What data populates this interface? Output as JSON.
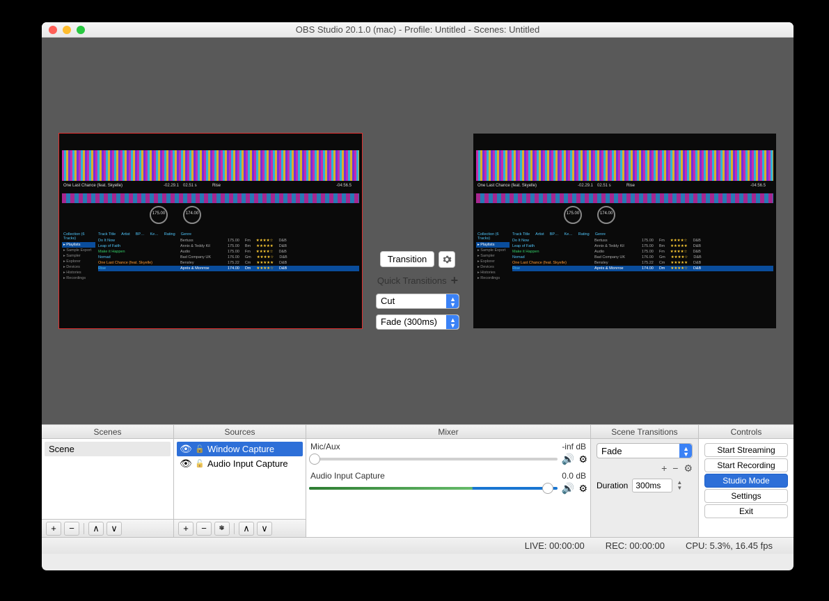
{
  "window": {
    "title": "OBS Studio 20.1.0 (mac) - Profile: Untitled - Scenes: Untitled"
  },
  "transition": {
    "button": "Transition",
    "quick_label": "Quick Transitions",
    "options": [
      "Cut",
      "Fade (300ms)"
    ]
  },
  "panels": {
    "scenes_hdr": "Scenes",
    "sources_hdr": "Sources",
    "mixer_hdr": "Mixer",
    "transitions_hdr": "Scene Transitions",
    "controls_hdr": "Controls"
  },
  "scenes": {
    "items": [
      "Scene"
    ]
  },
  "sources": {
    "items": [
      {
        "name": "Window Capture",
        "selected": true
      },
      {
        "name": "Audio Input Capture",
        "selected": false
      }
    ]
  },
  "mixer": {
    "channels": [
      {
        "name": "Mic/Aux",
        "level": "-inf dB",
        "pos": 0,
        "fill": 0,
        "blue": false
      },
      {
        "name": "Audio Input Capture",
        "level": "0.0 dB",
        "pos": 94,
        "fill": 66,
        "blue": true
      }
    ]
  },
  "scene_transitions": {
    "selected": "Fade",
    "duration_label": "Duration",
    "duration_value": "300ms"
  },
  "controls": {
    "buttons": [
      "Start Streaming",
      "Start Recording",
      "Studio Mode",
      "Settings",
      "Exit"
    ],
    "active_index": 2
  },
  "status": {
    "live": "LIVE: 00:00:00",
    "rec": "REC: 00:00:00",
    "cpu": "CPU: 5.3%, 16.45 fps"
  },
  "preview_content": {
    "track1": "One Last Chance (feat. Skyelle)",
    "track2": "Rise",
    "time1": "-02.29.1",
    "time1b": "02.51 s",
    "time2": "-04:56.5",
    "bpm1": "175.00",
    "bpm2": "174.00",
    "browser_header": [
      "Track Title",
      "Artist",
      "BP…",
      "Ke…",
      "Rating",
      "Genre"
    ],
    "sidebar": [
      "Playlists",
      "Sample Export",
      "Sampler",
      "Explorer",
      "Devices",
      "Histories",
      "Recordings"
    ],
    "collection_label": "Collection (6 Tracks)",
    "rows": [
      {
        "title": "Do It Now",
        "artist": "Bertuss",
        "bpm": "175.00",
        "key": "Fm",
        "rating": "★★★★☆",
        "genre": "D&B"
      },
      {
        "title": "Leap of Faith",
        "artist": "Annix & Teddy Kil",
        "bpm": "175.00",
        "key": "Bm",
        "rating": "★★★★★",
        "genre": "D&B"
      },
      {
        "title": "Make it Happen",
        "artist": "Audio",
        "bpm": "175.00",
        "key": "Fm",
        "rating": "★★★★☆",
        "genre": "D&B"
      },
      {
        "title": "Nomad",
        "artist": "Bad Company UK",
        "bpm": "176.00",
        "key": "Gm",
        "rating": "★★★★☆",
        "genre": "D&B"
      },
      {
        "title": "One Last Chance (feat. Skyelle)",
        "artist": "Bensley",
        "bpm": "175.22",
        "key": "Cm",
        "rating": "★★★★★",
        "genre": "D&B"
      },
      {
        "title": "Rise",
        "artist": "Aprés & Monrroe",
        "bpm": "174.00",
        "key": "Dm",
        "rating": "★★★★☆",
        "genre": "D&B"
      }
    ]
  }
}
